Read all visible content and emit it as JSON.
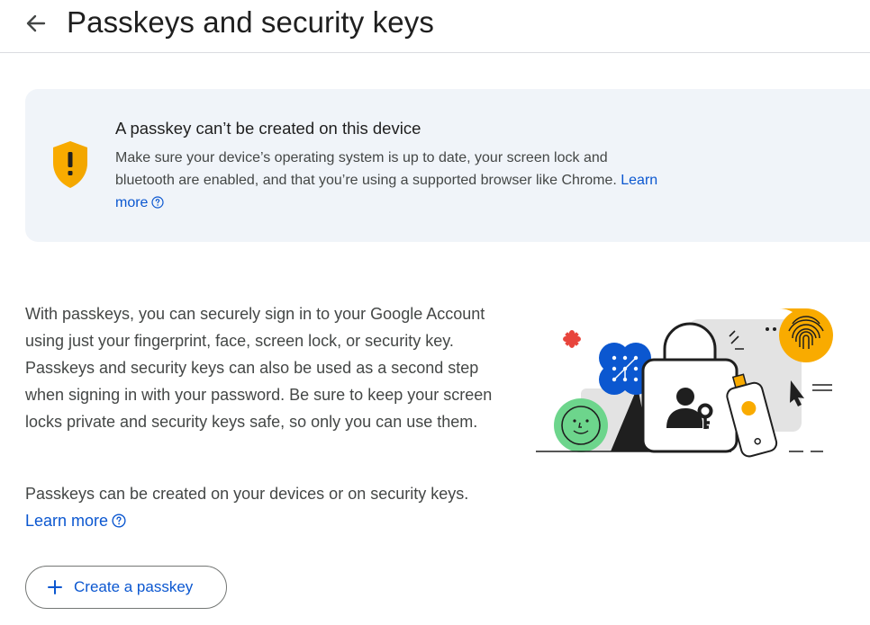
{
  "header": {
    "title": "Passkeys and security keys"
  },
  "warning": {
    "title": "A passkey can’t be created on this device",
    "body": "Make sure your device’s operating system is up to date, your screen lock and bluetooth are enabled, and that you’re using a supported browser like Chrome.",
    "link_label": "Learn more"
  },
  "intro": {
    "paragraph1": "With passkeys, you can securely sign in to your Google Account using just your fingerprint, face, screen lock, or security key. Passkeys and security keys can also be used as a second step when signing in with your password. Be sure to keep your screen locks private and security keys safe, so only you can use them.",
    "paragraph2": "Passkeys can be created on your devices or on security keys.",
    "link_label": "Learn more"
  },
  "actions": {
    "create_label": "Create a passkey"
  },
  "colors": {
    "accent": "#0b57d0",
    "warning": "#f9ab00",
    "card_bg": "#f0f4f9"
  },
  "icons": [
    "back-arrow-icon",
    "warning-shield-icon",
    "help-icon",
    "plus-icon",
    "passkey-illustration"
  ]
}
